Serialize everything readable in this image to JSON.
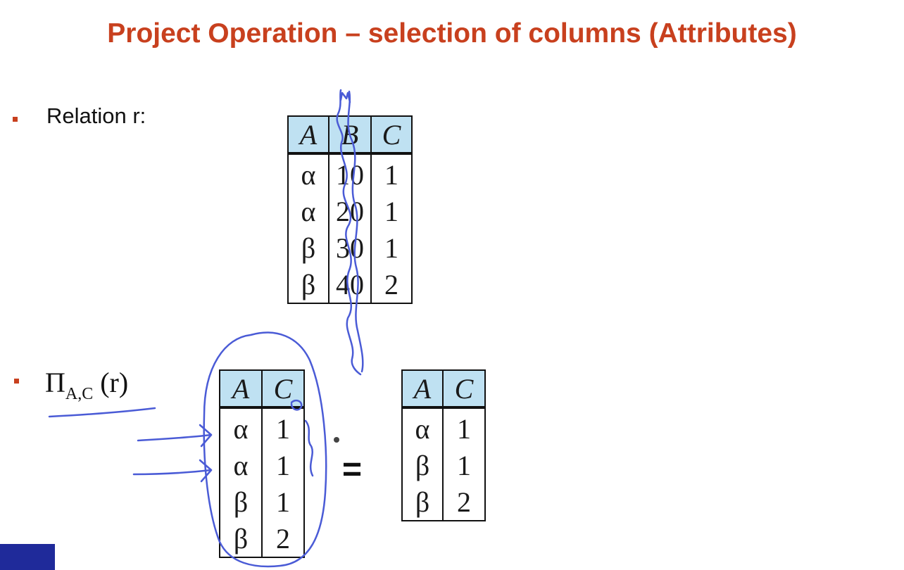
{
  "slide": {
    "title": "Project Operation – selection of columns (Attributes)",
    "relation_label": "Relation r:",
    "projection": {
      "pi": "Π",
      "subscript": "A,C",
      "argument": "(r)"
    },
    "equals": "="
  },
  "relation_r": {
    "headers": [
      "A",
      "B",
      "C"
    ],
    "rows": [
      [
        "α",
        "10",
        "1"
      ],
      [
        "α",
        "20",
        "1"
      ],
      [
        "β",
        "30",
        "1"
      ],
      [
        "β",
        "40",
        "2"
      ]
    ]
  },
  "projection_intermediate": {
    "headers": [
      "A",
      "C"
    ],
    "rows": [
      [
        "α",
        "1"
      ],
      [
        "α",
        "1"
      ],
      [
        "β",
        "1"
      ],
      [
        "β",
        "2"
      ]
    ]
  },
  "projection_result": {
    "headers": [
      "A",
      "C"
    ],
    "rows": [
      [
        "α",
        "1"
      ],
      [
        "β",
        "1"
      ],
      [
        "β",
        "2"
      ]
    ]
  },
  "colors": {
    "title": "#c8401e",
    "header_fill": "#bfe1f2",
    "ink": "#4a5bd6",
    "corner": "#1f2a9a"
  }
}
